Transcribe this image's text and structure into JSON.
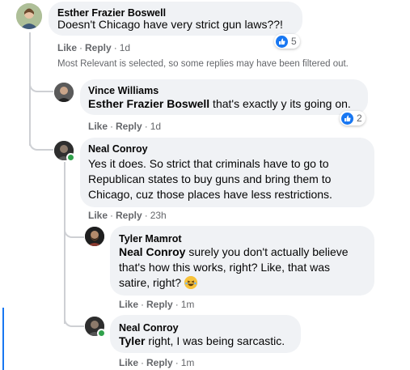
{
  "comment_main": {
    "author": "Esther Frazier Boswell",
    "text": "Doesn't Chicago have very strict gun laws??!",
    "like": "Like",
    "reply": "Reply",
    "time": "1d",
    "reaction_count": "5"
  },
  "filter_notice": "Most Relevant is selected, so some replies may have been filtered out.",
  "replies": [
    {
      "author": "Vince Williams",
      "mention": "Esther Frazier Boswell",
      "text": " that's exactly y its going on.",
      "like": "Like",
      "reply": "Reply",
      "time": "1d",
      "reaction_count": "2"
    },
    {
      "author": "Neal Conroy",
      "line1": "Yes it does. So strict that criminals have to go to",
      "line2": "Republican states to buy guns and bring them to",
      "line3": "Chicago, cuz those places have less restrictions.",
      "like": "Like",
      "reply": "Reply",
      "time": "23h"
    },
    {
      "author": "Tyler Mamrot",
      "mention": "Neal Conroy",
      "line1": " surely you don't actually believe",
      "line2": "that's how this works, right? Like, that was",
      "line3": "satire, right?",
      "like": "Like",
      "reply": "Reply",
      "time": "1m"
    },
    {
      "author": "Neal Conroy",
      "mention": "Tyler",
      "text": " right, I was being sarcastic.",
      "like": "Like",
      "reply": "Reply",
      "time": "1m"
    }
  ],
  "colors": {
    "bubble": "#f0f2f5",
    "meta": "#65676b",
    "like_blue": "#1877f2",
    "online": "#31a24c",
    "thread_line": "#ced0d4"
  }
}
